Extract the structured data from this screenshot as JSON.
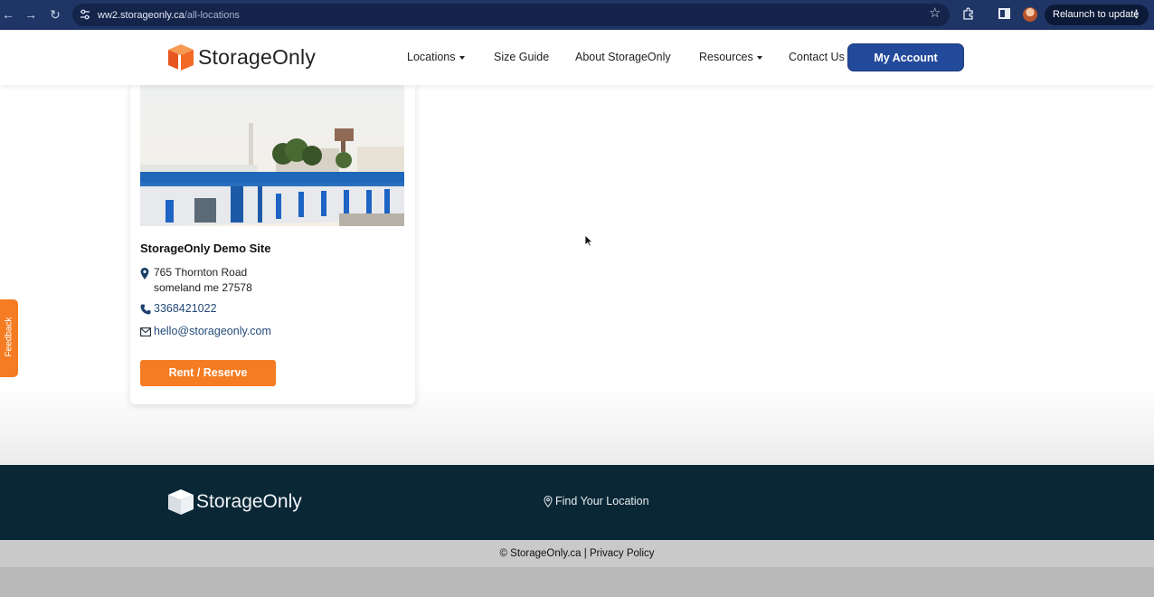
{
  "browser": {
    "url_host": "ww2.storageonly.ca",
    "url_path": "/all-locations",
    "relaunch_label": "Relaunch to update",
    "more_label": "⋮"
  },
  "header": {
    "logo_text": "StorageOnly",
    "nav": [
      {
        "label": "Locations"
      },
      {
        "label": "Size Guide"
      },
      {
        "label": "About StorageOnly"
      },
      {
        "label": "Resources"
      },
      {
        "label": "Contact Us"
      }
    ],
    "account_label": "My Account"
  },
  "location": {
    "name": "StorageOnly Demo Site",
    "address_line1": "765 Thornton Road",
    "address_line2": "someland me 27578",
    "phone": "3368421022",
    "email": "hello@storageonly.com",
    "cta_label": "Rent / Reserve"
  },
  "feedback_label": "Feedback",
  "footer": {
    "logo_text": "StorageOnly",
    "find_location": "Find Your Location",
    "copyright": "© StorageOnly.ca | Privacy Policy"
  },
  "colors": {
    "browser_bar": "#1f3565",
    "brand_orange": "#f57c22",
    "brand_blue": "#234a9a",
    "footer_bg": "#0a2735"
  }
}
